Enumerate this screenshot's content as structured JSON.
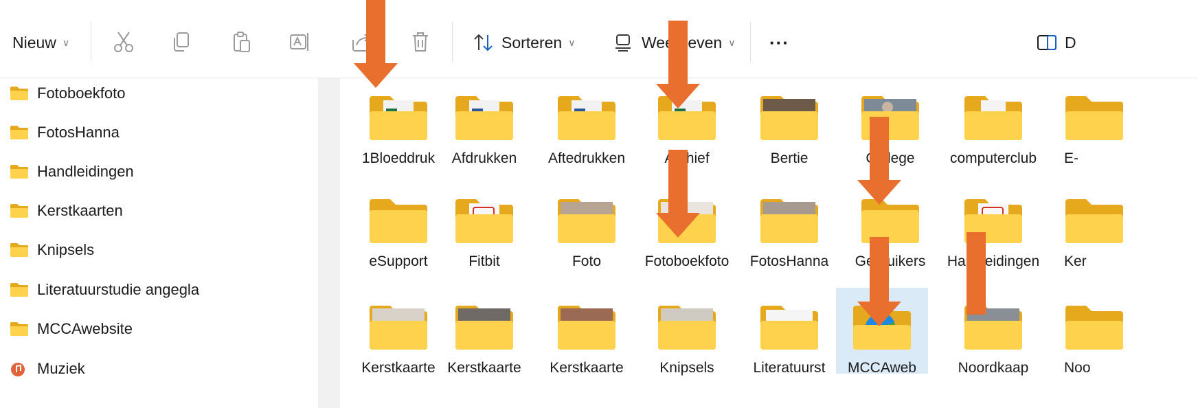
{
  "toolbar": {
    "new_label": "Nieuw",
    "sort_label": "Sorteren",
    "view_label": "Weergeven",
    "more_label": "···",
    "details_label": "D"
  },
  "sidebar": {
    "items": [
      {
        "label": "Fotoboekfoto"
      },
      {
        "label": "FotosHanna"
      },
      {
        "label": "Handleidingen"
      },
      {
        "label": "Kerstkaarten"
      },
      {
        "label": "Knipsels"
      },
      {
        "label": "Literatuurstudie angegla"
      },
      {
        "label": "MCCAwebsite"
      },
      {
        "label": "Muziek"
      }
    ]
  },
  "folders": {
    "row1": [
      {
        "label": "1Bloeddruk"
      },
      {
        "label": "Afdrukken"
      },
      {
        "label": "Aftedrukken"
      },
      {
        "label": "Archief"
      },
      {
        "label": "Bertie"
      },
      {
        "label": "College"
      },
      {
        "label": "computerclub"
      },
      {
        "label": "E-"
      }
    ],
    "row2": [
      {
        "label": "eSupport"
      },
      {
        "label": "Fitbit"
      },
      {
        "label": "Foto"
      },
      {
        "label": "Fotoboekfoto"
      },
      {
        "label": "FotosHanna"
      },
      {
        "label": "Gebruikers"
      },
      {
        "label": "Handleidingen"
      },
      {
        "label": "Ker"
      }
    ],
    "row3": [
      {
        "label": "Kerstkaarte"
      },
      {
        "label": "Kerstkaarte"
      },
      {
        "label": "Kerstkaarte"
      },
      {
        "label": "Knipsels"
      },
      {
        "label": "Literatuurst"
      },
      {
        "label": "MCCAweb"
      },
      {
        "label": "Noordkaap"
      },
      {
        "label": "Noo"
      }
    ]
  },
  "colors": {
    "folder_back": "#e6a81d",
    "folder_front": "#ffd24d",
    "arrow": "#e86f2e",
    "selection": "#dbeaf7"
  }
}
